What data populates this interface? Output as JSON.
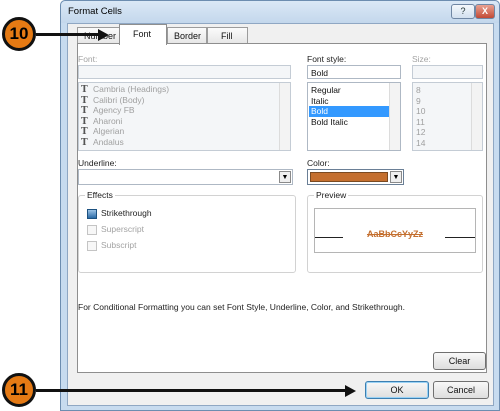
{
  "window": {
    "title": "Format Cells",
    "help_label": "?",
    "close_label": "X"
  },
  "tabs": [
    {
      "label": "Number"
    },
    {
      "label": "Font"
    },
    {
      "label": "Border"
    },
    {
      "label": "Fill"
    }
  ],
  "font": {
    "label": "Font:",
    "value": "",
    "items": [
      "Cambria (Headings)",
      "Calibri (Body)",
      "Agency FB",
      "Aharoni",
      "Algerian",
      "Andalus"
    ],
    "icon": "truetype-font-icon"
  },
  "font_style": {
    "label": "Font style:",
    "value": "Bold",
    "items": [
      "Regular",
      "Italic",
      "Bold",
      "Bold Italic"
    ],
    "selected": "Bold"
  },
  "size": {
    "label": "Size:",
    "value": "",
    "items": [
      "8",
      "9",
      "10",
      "11",
      "12",
      "14"
    ]
  },
  "underline": {
    "label": "Underline:",
    "value": ""
  },
  "color": {
    "label": "Color:",
    "value_hex": "#c46f2f"
  },
  "effects": {
    "title": "Effects",
    "strikethrough": {
      "label": "Strikethrough",
      "checked": true
    },
    "superscript": {
      "label": "Superscript",
      "checked": false
    },
    "subscript": {
      "label": "Subscript",
      "checked": false
    }
  },
  "preview": {
    "title": "Preview",
    "sample": "AaBbCcYyZz",
    "sample_color": "#c46f2f"
  },
  "info_text": "For Conditional Formatting you can set Font Style, Underline, Color, and Strikethrough.",
  "buttons": {
    "clear": "Clear",
    "ok": "OK",
    "cancel": "Cancel"
  },
  "callouts": [
    {
      "number": "10"
    },
    {
      "number": "11"
    }
  ]
}
